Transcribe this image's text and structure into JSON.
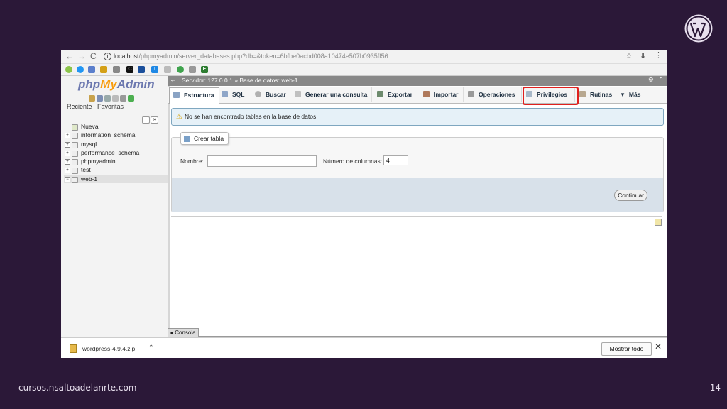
{
  "slide": {
    "footer": "cursos.nsaltoadelanrte.com",
    "page_number": "14",
    "logo_icon": "wordpress-logo-icon"
  },
  "browser": {
    "url_host": "localhost",
    "url_path": "/phpmyadmin/server_databases.php?db=&token=6bfbe0acbd008a10474e507b0935ff56",
    "bookmarks": [
      "bookmark-icon",
      "bookmark-icon",
      "bookmark-icon",
      "bookmark-icon",
      "bookmark-icon",
      "C",
      "bookmark-icon",
      "T",
      "bookmark-icon",
      "bookmark-icon",
      "bookmark-icon",
      "E"
    ]
  },
  "sidebar": {
    "logo_php": "php",
    "logo_my": "My",
    "logo_admin": "Admin",
    "tab_recent": "Reciente",
    "tab_favorites": "Favoritas",
    "tree": [
      {
        "label": "Nueva"
      },
      {
        "label": "information_schema"
      },
      {
        "label": "mysql"
      },
      {
        "label": "performance_schema"
      },
      {
        "label": "phpmyadmin"
      },
      {
        "label": "test"
      },
      {
        "label": "web-1"
      }
    ]
  },
  "breadcrumb": {
    "server": "Servidor: 127.0.0.1",
    "separator": "»",
    "database": "Base de datos: web-1"
  },
  "tabs": [
    {
      "label": "Estructura"
    },
    {
      "label": "SQL"
    },
    {
      "label": "Buscar"
    },
    {
      "label": "Generar una consulta"
    },
    {
      "label": "Exportar"
    },
    {
      "label": "Importar"
    },
    {
      "label": "Operaciones"
    },
    {
      "label": "Privilegios"
    },
    {
      "label": "Rutinas"
    },
    {
      "label": "Más"
    }
  ],
  "notice": {
    "text": "No se han encontrado tablas en la base de datos."
  },
  "create_table": {
    "legend": "Crear tabla",
    "name_label": "Nombre:",
    "name_value": "",
    "columns_label": "Número de columnas:",
    "columns_value": "4",
    "continue_label": "Continuar"
  },
  "console": {
    "label": "Consola"
  },
  "download_shelf": {
    "file_name": "wordpress-4.9.4.zip",
    "show_all_label": "Mostrar todo"
  },
  "colors": {
    "slide_bg": "#2b1838",
    "highlight": "#e0201e",
    "notice_bg": "#e6f1f8"
  }
}
